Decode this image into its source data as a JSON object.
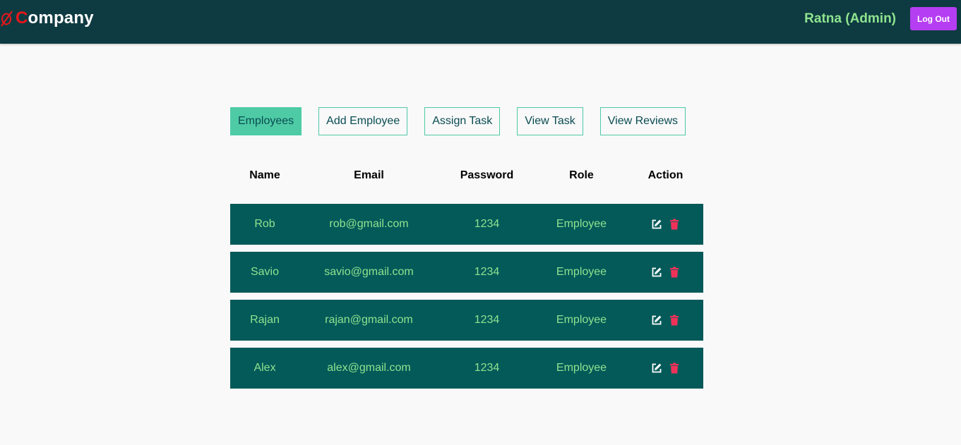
{
  "navbar": {
    "brand_first": "C",
    "brand_rest": "ompany",
    "user": "Ratna (Admin)",
    "logout_label": "Log Out"
  },
  "tabs": [
    {
      "label": "Employees",
      "active": true
    },
    {
      "label": "Add Employee",
      "active": false
    },
    {
      "label": "Assign Task",
      "active": false
    },
    {
      "label": "View Task",
      "active": false
    },
    {
      "label": "View Reviews",
      "active": false
    }
  ],
  "table": {
    "headers": [
      "Name",
      "Email",
      "Password",
      "Role",
      "Action"
    ],
    "rows": [
      {
        "name": "Rob",
        "email": "rob@gmail.com",
        "password": "1234",
        "role": "Employee"
      },
      {
        "name": "Savio",
        "email": "savio@gmail.com",
        "password": "1234",
        "role": "Employee"
      },
      {
        "name": "Rajan",
        "email": "rajan@gmail.com",
        "password": "1234",
        "role": "Employee"
      },
      {
        "name": "Alex",
        "email": "alex@gmail.com",
        "password": "1234",
        "role": "Employee"
      }
    ]
  },
  "icons": {
    "edit": "edit-icon",
    "delete": "trash-icon"
  },
  "colors": {
    "navbar": "#0e3b41",
    "accent": "#4ecba5",
    "row_bg": "#035a59",
    "row_text": "#8fe38f",
    "logout": "#b53ef2",
    "delete": "#f0325a"
  }
}
